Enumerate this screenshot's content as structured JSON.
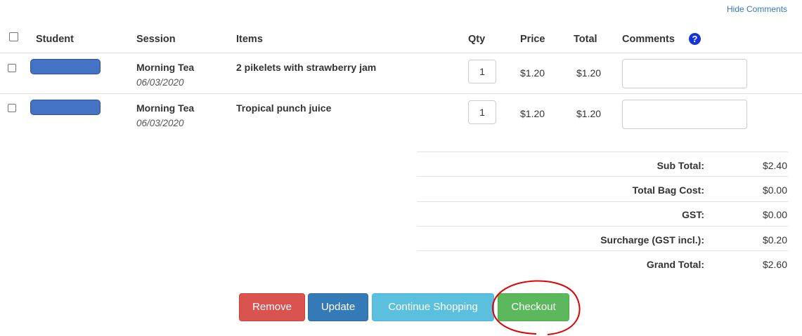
{
  "header": {
    "hide_comments": "Hide Comments"
  },
  "columns": {
    "student": "Student",
    "session": "Session",
    "items": "Items",
    "qty": "Qty",
    "price": "Price",
    "total": "Total",
    "comments": "Comments"
  },
  "help_icon": {
    "glyph": "?",
    "icon": "question-circle-icon",
    "color": "#1533d6"
  },
  "rows": [
    {
      "session": "Morning Tea",
      "date": "06/03/2020",
      "item": "2 pikelets with strawberry jam",
      "qty": "1",
      "price": "$1.20",
      "total": "$1.20",
      "comment": ""
    },
    {
      "session": "Morning Tea",
      "date": "06/03/2020",
      "item": "Tropical punch juice",
      "qty": "1",
      "price": "$1.20",
      "total": "$1.20",
      "comment": ""
    }
  ],
  "summary": {
    "subtotal_label": "Sub Total:",
    "subtotal": "$2.40",
    "bag_label": "Total Bag Cost:",
    "bag": "$0.00",
    "gst_label": "GST:",
    "gst": "$0.00",
    "surcharge_label": "Surcharge (GST incl.):",
    "surcharge": "$0.20",
    "grand_label": "Grand Total:",
    "grand": "$2.60"
  },
  "buttons": {
    "remove": "Remove",
    "update": "Update",
    "continue": "Continue Shopping",
    "checkout": "Checkout"
  },
  "colors": {
    "remove": "#d9534f",
    "update": "#337ab7",
    "continue": "#5bc0de",
    "checkout": "#5cb85c",
    "highlight_circle": "#e00000",
    "redacted": "#4472c4"
  }
}
